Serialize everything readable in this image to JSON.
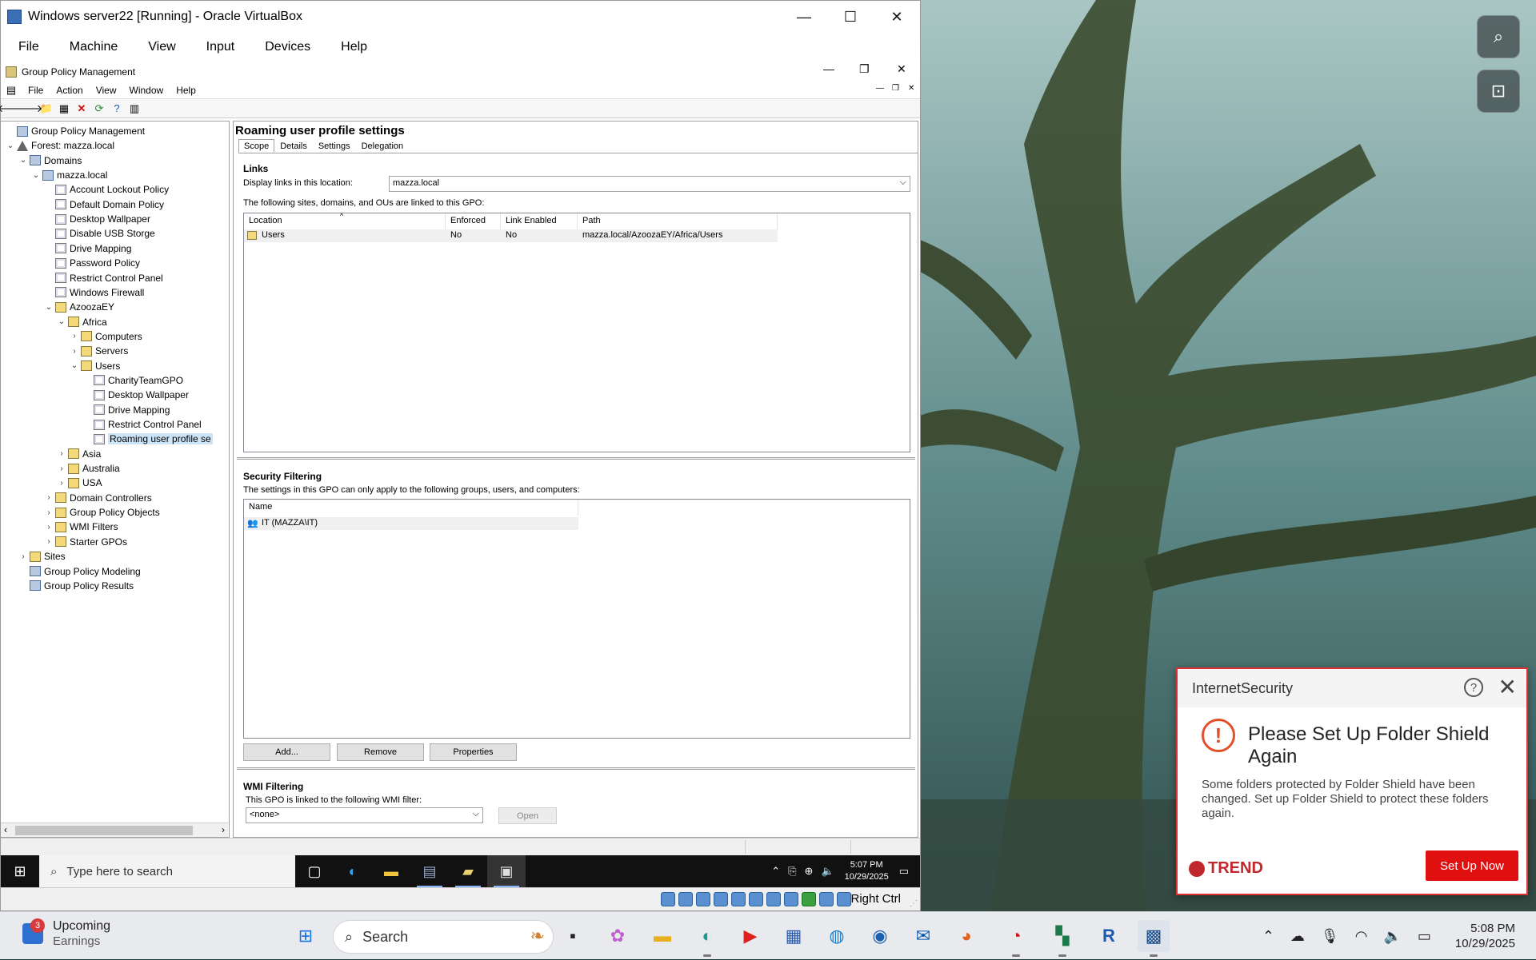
{
  "vbox": {
    "title": "Windows server22 [Running] - Oracle VirtualBox",
    "menu": [
      "File",
      "Machine",
      "View",
      "Input",
      "Devices",
      "Help"
    ],
    "status_key": "Right Ctrl"
  },
  "gpm": {
    "title": "Group Policy Management",
    "menu": [
      "File",
      "Action",
      "View",
      "Window",
      "Help"
    ],
    "tree": [
      {
        "label": "Group Policy Management",
        "level": 0,
        "exp": "",
        "icon": "gpm-icon"
      },
      {
        "label": "Forest: mazza.local",
        "level": 0,
        "exp": "v",
        "icon": "forest-icon"
      },
      {
        "label": "Domains",
        "level": 1,
        "exp": "v",
        "icon": "domains-icon"
      },
      {
        "label": "mazza.local",
        "level": 2,
        "exp": "v",
        "icon": "domain-icon"
      },
      {
        "label": "Account Lockout Policy",
        "level": 3,
        "exp": "",
        "icon": "gpo-link-icon"
      },
      {
        "label": "Default Domain Policy",
        "level": 3,
        "exp": "",
        "icon": "gpo-link-icon"
      },
      {
        "label": "Desktop Wallpaper",
        "level": 3,
        "exp": "",
        "icon": "gpo-link-icon"
      },
      {
        "label": "Disable USB Storge",
        "level": 3,
        "exp": "",
        "icon": "gpo-link-icon"
      },
      {
        "label": "Drive Mapping",
        "level": 3,
        "exp": "",
        "icon": "gpo-link-icon"
      },
      {
        "label": "Password Policy",
        "level": 3,
        "exp": "",
        "icon": "gpo-link-icon"
      },
      {
        "label": "Restrict Control Panel",
        "level": 3,
        "exp": "",
        "icon": "gpo-link-icon"
      },
      {
        "label": "Windows Firewall",
        "level": 3,
        "exp": "",
        "icon": "gpo-link-icon"
      },
      {
        "label": "AzoozaEY",
        "level": 3,
        "exp": "v",
        "icon": "ou-icon"
      },
      {
        "label": "Africa",
        "level": 4,
        "exp": "v",
        "icon": "ou-icon"
      },
      {
        "label": "Computers",
        "level": 5,
        "exp": ">",
        "icon": "ou-icon"
      },
      {
        "label": "Servers",
        "level": 5,
        "exp": ">",
        "icon": "ou-icon"
      },
      {
        "label": "Users",
        "level": 5,
        "exp": "v",
        "icon": "ou-icon"
      },
      {
        "label": "CharityTeamGPO",
        "level": 6,
        "exp": "",
        "icon": "gpo-link-icon"
      },
      {
        "label": "Desktop Wallpaper",
        "level": 6,
        "exp": "",
        "icon": "gpo-link-icon"
      },
      {
        "label": "Drive Mapping",
        "level": 6,
        "exp": "",
        "icon": "gpo-link-icon"
      },
      {
        "label": "Restrict Control Panel",
        "level": 6,
        "exp": "",
        "icon": "gpo-link-icon"
      },
      {
        "label": "Roaming user profile se",
        "level": 6,
        "exp": "",
        "icon": "gpo-link-icon",
        "selected": true
      },
      {
        "label": "Asia",
        "level": 4,
        "exp": ">",
        "icon": "ou-icon"
      },
      {
        "label": "Australia",
        "level": 4,
        "exp": ">",
        "icon": "ou-icon"
      },
      {
        "label": "USA",
        "level": 4,
        "exp": ">",
        "icon": "ou-icon"
      },
      {
        "label": "Domain Controllers",
        "level": 3,
        "exp": ">",
        "icon": "ou-icon"
      },
      {
        "label": "Group Policy Objects",
        "level": 3,
        "exp": ">",
        "icon": "container-icon"
      },
      {
        "label": "WMI Filters",
        "level": 3,
        "exp": ">",
        "icon": "container-icon"
      },
      {
        "label": "Starter GPOs",
        "level": 3,
        "exp": ">",
        "icon": "container-icon"
      },
      {
        "label": "Sites",
        "level": 1,
        "exp": ">",
        "icon": "sites-icon"
      },
      {
        "label": "Group Policy Modeling",
        "level": 1,
        "exp": "",
        "icon": "modeling-icon"
      },
      {
        "label": "Group Policy Results",
        "level": 1,
        "exp": "",
        "icon": "results-icon"
      }
    ],
    "detail": {
      "title": "Roaming user profile settings",
      "tabs": [
        "Scope",
        "Details",
        "Settings",
        "Delegation"
      ],
      "links_heading": "Links",
      "display_links_label": "Display links in this location:",
      "display_links_value": "mazza.local",
      "linked_caption": "The following sites, domains, and OUs are linked to this GPO:",
      "links_columns": [
        "Location",
        "Enforced",
        "Link Enabled",
        "Path"
      ],
      "links_rows": [
        {
          "location": "Users",
          "enforced": "No",
          "link_enabled": "No",
          "path": "mazza.local/AzoozaEY/Africa/Users"
        }
      ],
      "security_heading": "Security Filtering",
      "security_caption": "The settings in this GPO can only apply to the following groups, users, and computers:",
      "security_columns": [
        "Name"
      ],
      "security_rows": [
        "IT (MAZZA\\IT)"
      ],
      "buttons": {
        "add": "Add...",
        "remove": "Remove",
        "properties": "Properties"
      },
      "wmi_heading": "WMI Filtering",
      "wmi_caption": "This GPO is linked to the following WMI filter:",
      "wmi_value": "<none>",
      "wmi_open": "Open"
    }
  },
  "guest_taskbar": {
    "search_placeholder": "Type here to search",
    "time": "5:07 PM",
    "date": "10/29/2025"
  },
  "toast": {
    "brand": "InternetSecurity",
    "headline": "Please Set Up Folder Shield Again",
    "body": "Some folders protected by Folder Shield have been changed. Set up Folder Shield to protect these folders again.",
    "logo": "TREND",
    "cta": "Set Up Now"
  },
  "host_taskbar": {
    "weather_badge": "3",
    "weather_title": "Upcoming",
    "weather_sub": "Earnings",
    "search_placeholder": "Search",
    "time": "5:08 PM",
    "date": "10/29/2025"
  },
  "colors": {
    "toast_accent": "#e01010",
    "trend_red": "#c0282d",
    "selection": "#cce4f7"
  }
}
